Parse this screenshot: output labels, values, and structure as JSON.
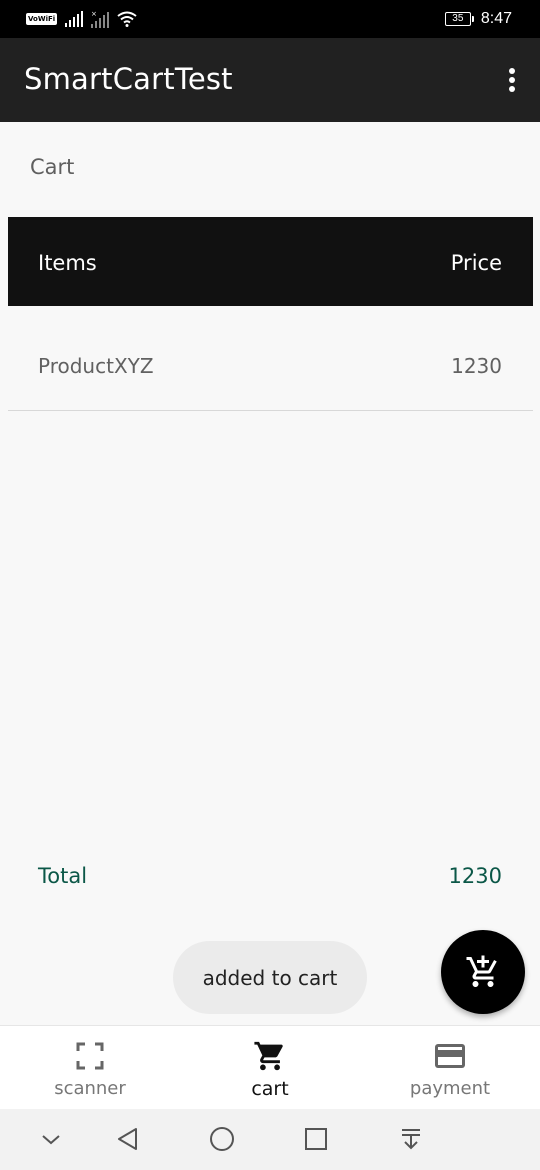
{
  "status_bar": {
    "network_badge": "VoWiFi",
    "battery_level": "35",
    "time": "8:47",
    "icons": [
      "vowifi-icon",
      "signal-icon",
      "signal-no-service-icon",
      "wifi-icon",
      "battery-icon"
    ]
  },
  "app_bar": {
    "title": "SmartCartTest",
    "menu_icon": "overflow-menu-icon"
  },
  "cart": {
    "section_label": "Cart",
    "columns": {
      "items": "Items",
      "price": "Price"
    },
    "rows": [
      {
        "name": "ProductXYZ",
        "price": "1230"
      }
    ],
    "total_label": "Total",
    "total_value": "1230"
  },
  "toast": {
    "message": "added to cart"
  },
  "fab": {
    "icon": "add-shopping-cart-icon"
  },
  "bottom_nav": {
    "items": [
      {
        "label": "scanner",
        "icon": "scanner-frame-icon",
        "active": false
      },
      {
        "label": "cart",
        "icon": "shopping-cart-icon",
        "active": true
      },
      {
        "label": "payment",
        "icon": "credit-card-icon",
        "active": false
      }
    ]
  },
  "system_nav": {
    "icons": [
      "collapse-chevron-icon",
      "back-triangle-icon",
      "home-circle-icon",
      "recents-square-icon",
      "notification-pull-icon"
    ]
  },
  "colors": {
    "app_bar": "#212121",
    "status_bar": "#000000",
    "table_header": "#111111",
    "total_accent": "#0b5747",
    "background": "#f8f8f8"
  }
}
